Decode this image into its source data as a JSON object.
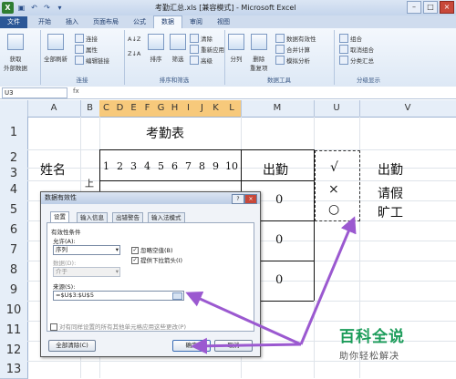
{
  "window": {
    "title": "考勤汇总.xls [兼容模式] - Microsoft Excel",
    "buttons": [
      "–",
      "□",
      "×"
    ]
  },
  "qat_icons": [
    "excel-logo-icon",
    "save-icon",
    "undo-icon",
    "redo-icon",
    "dropdown-icon"
  ],
  "tabs": [
    "文件",
    "开始",
    "插入",
    "页面布局",
    "公式",
    "数据",
    "审阅",
    "视图"
  ],
  "ribbon": {
    "get_external": "获取\n外部数据",
    "refresh_all": "全部刷新",
    "conn": [
      "连接",
      "属性",
      "编辑链接"
    ],
    "conn_label": "连接",
    "sort_asc": "A↓Z",
    "sort_desc": "Z↓A",
    "sort": "排序",
    "filter": "筛选",
    "filter_opts": [
      "清除",
      "重新应用",
      "高级"
    ],
    "sort_label": "排序和筛选",
    "split": "分列",
    "remove_dup": "删除\n重复项",
    "tools": [
      "数据有效性",
      "合并计算",
      "模拟分析"
    ],
    "tools_label": "数据工具",
    "outline": [
      "组合",
      "取消组合",
      "分类汇总"
    ],
    "outline_label": "分级显示"
  },
  "namebox": "U3",
  "fx": "fx",
  "columns": [
    "A",
    "B",
    "C",
    "D",
    "E",
    "F",
    "G",
    "H",
    "I",
    "J",
    "K",
    "L",
    "M",
    "U",
    "V"
  ],
  "rows": [
    "1",
    "2",
    "3",
    "4",
    "5",
    "6",
    "7",
    "8",
    "9",
    "10",
    "11",
    "12",
    "13"
  ],
  "sheet": {
    "title": "考勤表",
    "name_header": "姓名",
    "b3": "上",
    "days": [
      "1",
      "2",
      "3",
      "4",
      "5",
      "6",
      "7",
      "8",
      "9",
      "10"
    ],
    "attendance": "出勤",
    "zeros": [
      "0",
      "0",
      "0"
    ],
    "symbols": [
      "√",
      "×",
      "○"
    ],
    "legend": [
      "出勤",
      "请假",
      "旷工"
    ]
  },
  "dialog": {
    "title": "数据有效性",
    "help": "?",
    "close": "×",
    "tabs": [
      "设置",
      "输入信息",
      "出错警告",
      "输入法模式"
    ],
    "criteria": "有效性条件",
    "allow_label": "允许(A):",
    "allow_value": "序列",
    "ignore_blank": "忽略空值(B)",
    "dropdown": "提供下拉箭头(I)",
    "data_label": "数据(D):",
    "data_value": "介于",
    "source_label": "来源(S):",
    "source_value": "=$U$3:$U$5",
    "apply_all": "对有同样设置的所有其他单元格应用这些更改(P)",
    "clear_all": "全部清除(C)",
    "ok": "确定",
    "cancel": "取消"
  },
  "watermark": {
    "title": "百科全说",
    "subtitle": "助你轻松解决"
  },
  "colors": {
    "accent": "#9b59d0",
    "selected_col": "#f7c97b",
    "brand": "#1c9c5a"
  }
}
